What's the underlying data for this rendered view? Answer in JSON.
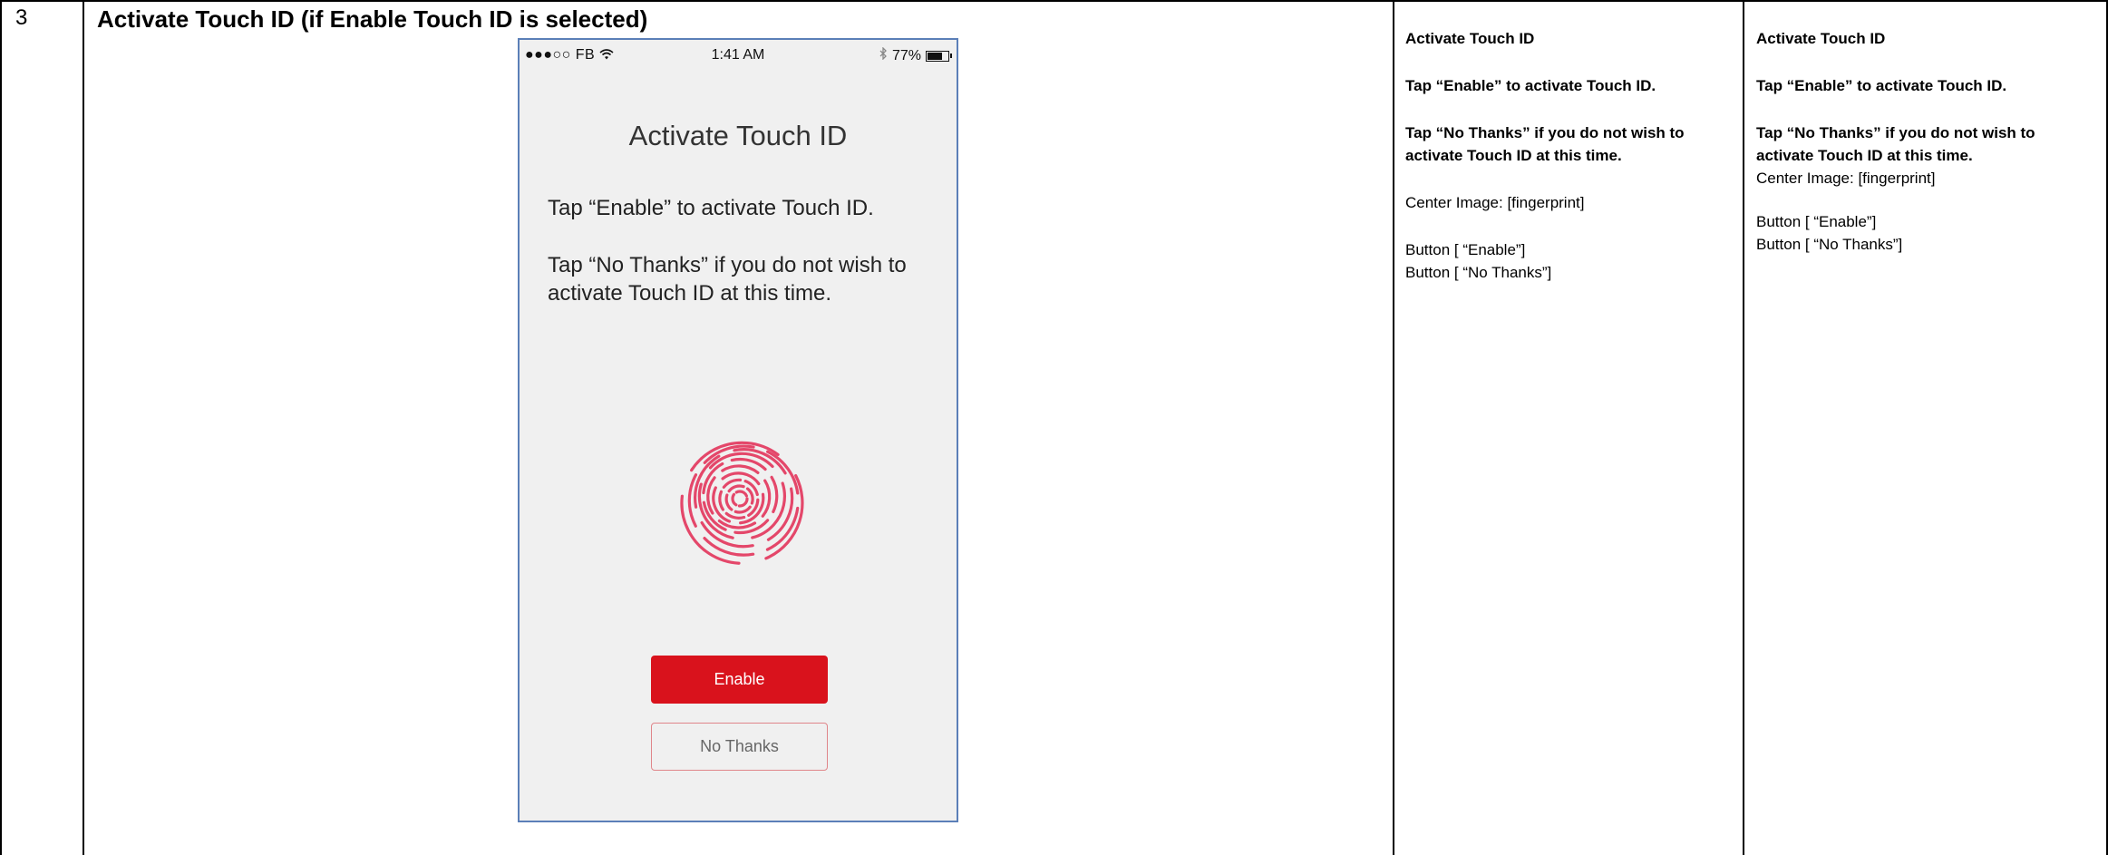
{
  "row": {
    "number": "3",
    "title": "Activate Touch ID (if Enable Touch ID is selected)"
  },
  "phone": {
    "status": {
      "carrier": "●●●○○ FB",
      "wifi_icon": "wifi-icon",
      "time": "1:41 AM",
      "bluetooth_icon": "bluetooth-icon",
      "battery_text": "77%",
      "battery_level": 0.77
    },
    "title": "Activate Touch ID",
    "line1": "Tap “Enable” to activate Touch ID.",
    "line2": "Tap “No Thanks” if you do not wish to activate Touch ID at this time.",
    "center_icon": "fingerprint-icon",
    "enable_label": "Enable",
    "no_thanks_label": "No Thanks",
    "colors": {
      "accent": "#d9121c",
      "fingerprint": "#e4476a",
      "background": "#f0f0f0"
    }
  },
  "spec_a": {
    "heading": "Activate Touch ID",
    "line1": "Tap “Enable” to activate Touch ID.",
    "line2": "Tap “No Thanks” if you do not wish to activate Touch ID at this time.",
    "center_image": "Center Image: [fingerprint]",
    "button1": "Button [ “Enable”]",
    "button2": "Button [ “No Thanks”]"
  },
  "spec_b": {
    "heading": "Activate Touch ID",
    "line1": "Tap “Enable” to activate Touch ID.",
    "line2": "Tap “No Thanks” if you do not wish to activate Touch ID at this time.",
    "center_image": "Center Image: [fingerprint]",
    "button1": "Button [ “Enable”]",
    "button2": "Button [ “No Thanks”]"
  }
}
